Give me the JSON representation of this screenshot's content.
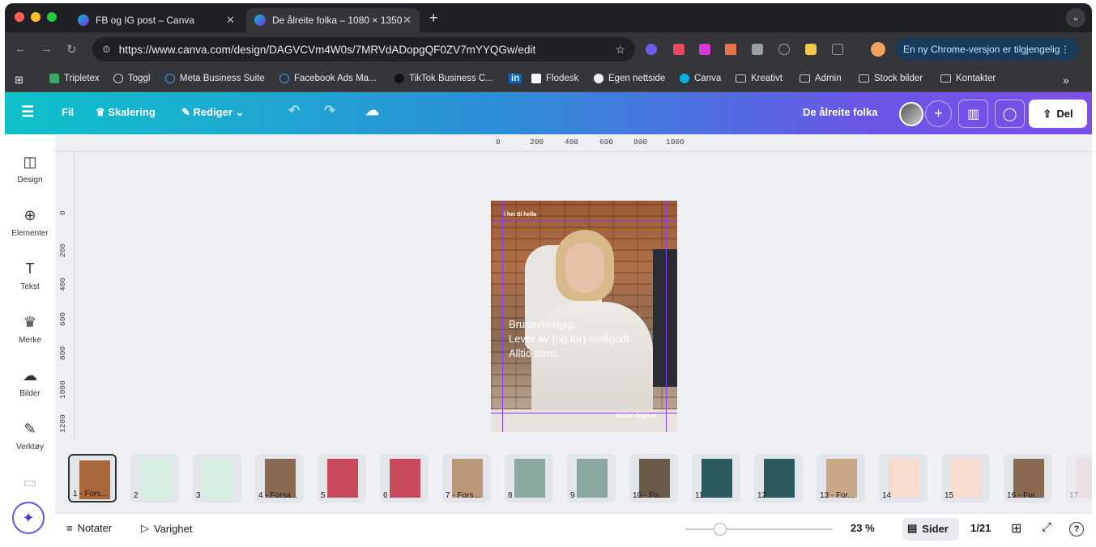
{
  "browser": {
    "tabs": [
      {
        "title": "FB og IG post – Canva"
      },
      {
        "title": "De ålreite folka – 1080 × 1350"
      }
    ],
    "url": "https://www.canva.com/design/DAGVCVm4W0s/7MRVdADopgQF0ZV7mYYQGw/edit",
    "update_notice": "En ny Chrome-versjon er tilgjengelig",
    "bookmarks": [
      "Tripletex",
      "Toggl",
      "Meta Business Suite",
      "Facebook Ads Ma...",
      "TikTok Business C...",
      "in",
      "Flodesk",
      "Egen nettside",
      "Canva",
      "Kreativt",
      "Admin",
      "Stock bilder",
      "Kontakter"
    ],
    "bookmarks_more": "»"
  },
  "canva": {
    "menu": {
      "file": "Fil",
      "resize": "Skalering",
      "edit": "Rediger",
      "title": "De ålreite folka",
      "share": "Del"
    },
    "sidebar": [
      {
        "label": "Design",
        "icon": "design-icon"
      },
      {
        "label": "Elementer",
        "icon": "elements-icon"
      },
      {
        "label": "Tekst",
        "icon": "text-icon"
      },
      {
        "label": "Merke",
        "icon": "brand-icon"
      },
      {
        "label": "Bilder",
        "icon": "images-icon"
      },
      {
        "label": "Verktøy",
        "icon": "tools-icon"
      }
    ],
    "ruler": {
      "h": [
        "0",
        "200",
        "400",
        "600",
        "800",
        "1000"
      ],
      "v": [
        "0",
        "200",
        "400",
        "600",
        "800",
        "1000",
        "1200"
      ]
    },
    "page": {
      "tag": "i hei til hella",
      "lines": [
        "Brusavhengig.",
        "Lever av (og for) smågodt.",
        "Alltid tomo."
      ],
      "footer": "digital rådgiver"
    },
    "thumbnails": [
      {
        "label": "1 - Fors...",
        "color": "#a8683c"
      },
      {
        "label": "2",
        "color": "#d6eee0"
      },
      {
        "label": "3",
        "color": "#d6eee0"
      },
      {
        "label": "4 - Forsa...",
        "color": "#8a6a52"
      },
      {
        "label": "5",
        "color": "#c84a5c"
      },
      {
        "label": "6",
        "color": "#c84a5c"
      },
      {
        "label": "7 - Fors...",
        "color": "#b89878"
      },
      {
        "label": "8",
        "color": "#8aa8a0"
      },
      {
        "label": "9",
        "color": "#8aa8a0"
      },
      {
        "label": "10 - Fo...",
        "color": "#6a5a4a"
      },
      {
        "label": "11",
        "color": "#2a5a5c"
      },
      {
        "label": "12",
        "color": "#2a5a5c"
      },
      {
        "label": "13 - For...",
        "color": "#c8a888"
      },
      {
        "label": "14",
        "color": "#f8dcd0"
      },
      {
        "label": "15",
        "color": "#f8dcd0"
      },
      {
        "label": "16 - For...",
        "color": "#8a6a52"
      },
      {
        "label": "17",
        "color": "#e8c8d0"
      }
    ],
    "bottom": {
      "notes": "Notater",
      "duration": "Varighet",
      "zoom": "23 %",
      "zoom_level": 0.23,
      "pages": "Sider",
      "page_count": "1/21"
    }
  }
}
